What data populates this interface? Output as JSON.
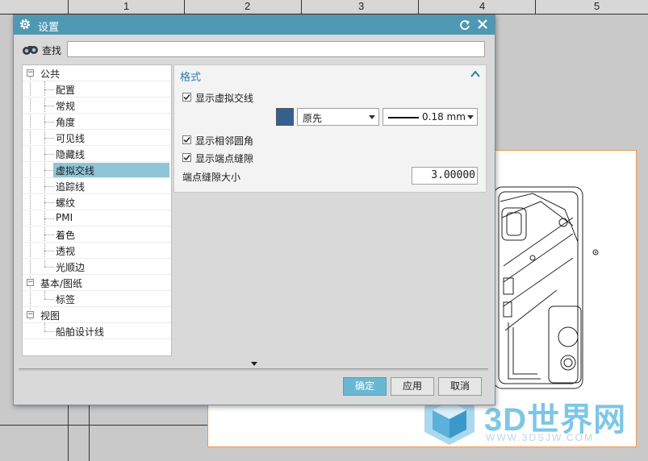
{
  "ruler": {
    "numbers": [
      "1",
      "2",
      "3",
      "4",
      "5"
    ]
  },
  "dialog": {
    "title": "设置",
    "search": {
      "label": "查找",
      "value": "",
      "placeholder": ""
    },
    "tree": {
      "groups": [
        {
          "label": "公共",
          "expander": "−",
          "items": [
            "配置",
            "常规",
            "角度",
            "可见线",
            "隐藏线",
            "虚拟交线",
            "追踪线",
            "螺纹",
            "PMI",
            "着色",
            "透视",
            "光顺边"
          ],
          "selected": "虚拟交线"
        },
        {
          "label": "基本/图纸",
          "expander": "−",
          "items": [
            "标签"
          ]
        },
        {
          "label": "视图",
          "expander": "−",
          "items": [
            "船舶设计线"
          ]
        }
      ]
    },
    "panel": {
      "title": "格式",
      "show_virtual_intersection": {
        "label": "显示虚拟交线",
        "checked": true
      },
      "color_swatch": "#34608f",
      "line_style": "原先",
      "line_width": "0.18 mm",
      "show_adjacent_fillet": {
        "label": "显示相邻圆角",
        "checked": true
      },
      "show_endpoint_gap": {
        "label": "显示端点缝隙",
        "checked": true
      },
      "endpoint_gap_size": {
        "label": "端点缝隙大小",
        "value": "3.00000"
      }
    },
    "buttons": {
      "ok": "确定",
      "apply": "应用",
      "cancel": "取消"
    }
  },
  "watermark": {
    "brand": "3D世界网",
    "url": "WWW.3DSJW.COM"
  }
}
